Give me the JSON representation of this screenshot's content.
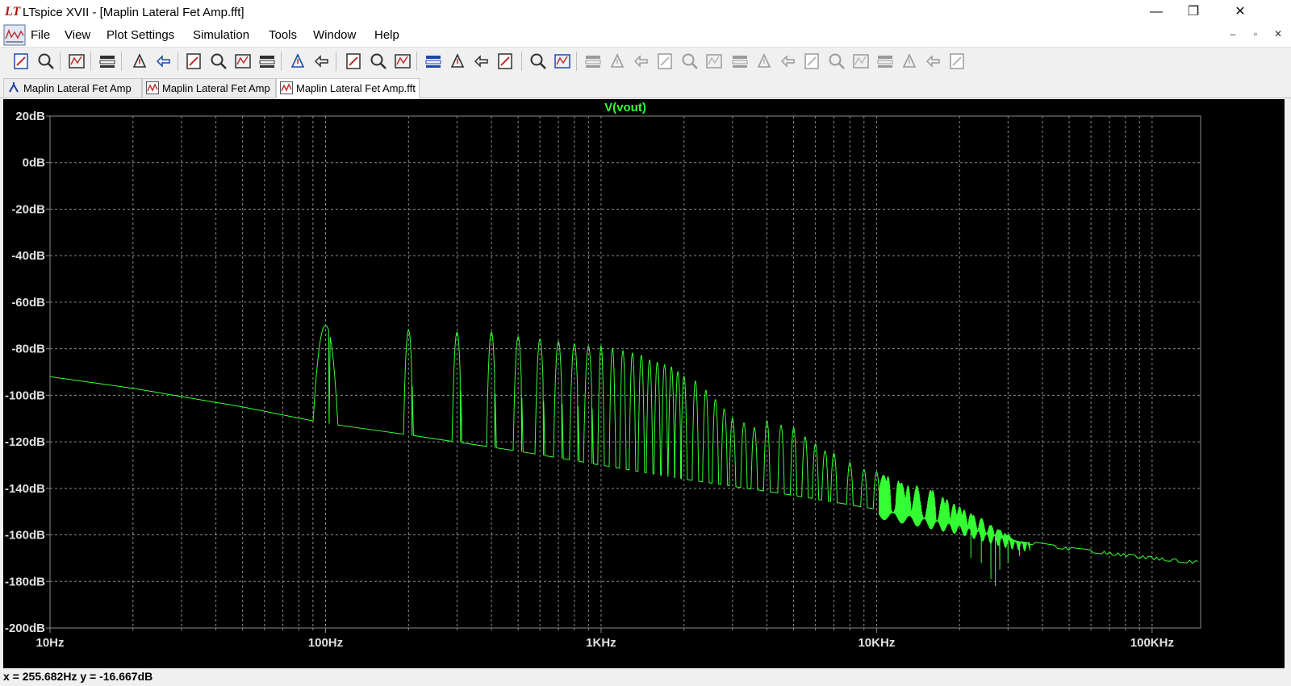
{
  "window": {
    "logo": "LT",
    "title": "LTspice XVII - [Maplin Lateral Fet Amp.fft]",
    "minimize": "—",
    "maximize": "❐",
    "close": "✕"
  },
  "menu": [
    "File",
    "View",
    "Plot Settings",
    "Simulation",
    "Tools",
    "Window",
    "Help"
  ],
  "mdi": {
    "minimize": "–",
    "restore": "▫",
    "close": "✕"
  },
  "toolbar_icons": [
    "new-schematic-icon",
    "open-icon",
    "save-icon",
    "control-panel-icon",
    "run-icon",
    "pan-hand-icon",
    "zoom-in-icon",
    "zoom-area-icon",
    "zoom-out-icon",
    "zoom-cancel-icon",
    "autorange-icon",
    "cursor-icon",
    "tile-horizontal-icon",
    "cascade-icon",
    "tile-vertical-icon",
    "cut-icon",
    "copy-icon",
    "paste-icon",
    "find-icon",
    "print-icon",
    "print-setup-icon",
    "wire-icon",
    "ground-icon",
    "label-icon",
    "resistor-icon",
    "capacitor-icon",
    "inductor-icon",
    "diode-icon",
    "component-icon",
    "move-icon",
    "drag-icon",
    "undo-icon",
    "redo-icon",
    "rotate-icon",
    "mirror-icon",
    "text-icon",
    "spice-directive-icon"
  ],
  "tabs": [
    {
      "label": "Maplin Lateral Fet Amp",
      "icon": "schematic-icon",
      "active": false
    },
    {
      "label": "Maplin Lateral Fet Amp",
      "icon": "waveform-icon",
      "active": false
    },
    {
      "label": "Maplin Lateral Fet Amp.fft",
      "icon": "waveform-icon",
      "active": true
    }
  ],
  "status": {
    "text": "x = 255.682Hz    y = -16.667dB"
  },
  "colors": {
    "trace": "#33ff33",
    "background": "#000000",
    "grid": "#8a8a8a",
    "axis_text": "#e0e0e0",
    "title": "#33ff33"
  },
  "chart_data": {
    "type": "line",
    "title": "V(vout)",
    "x_scale": "log",
    "xlim": [
      10,
      150000
    ],
    "ylim": [
      -200,
      20
    ],
    "x_ticks": [
      10,
      100,
      1000,
      10000,
      100000
    ],
    "x_tick_labels": [
      "10Hz",
      "100Hz",
      "1KHz",
      "10KHz",
      "100KHz"
    ],
    "y_ticks": [
      20,
      0,
      -20,
      -40,
      -60,
      -80,
      -100,
      -120,
      -140,
      -160,
      -180,
      -200
    ],
    "y_tick_labels": [
      "20dB",
      "0dB",
      "-20dB",
      "-40dB",
      "-60dB",
      "-80dB",
      "-100dB",
      "-120dB",
      "-140dB",
      "-160dB",
      "-180dB",
      "-200dB"
    ],
    "grid": true,
    "series": [
      {
        "name": "V(vout)",
        "noise_floor": [
          [
            10,
            -92
          ],
          [
            20,
            -97
          ],
          [
            50,
            -105
          ],
          [
            90,
            -111
          ],
          [
            100,
            -112
          ],
          [
            200,
            -117
          ],
          [
            500,
            -124
          ],
          [
            1000,
            -130
          ],
          [
            2000,
            -136
          ],
          [
            5000,
            -143
          ],
          [
            10000,
            -149
          ],
          [
            20000,
            -156
          ],
          [
            30000,
            -162
          ],
          [
            50000,
            -166
          ],
          [
            100000,
            -170
          ],
          [
            150000,
            -172
          ]
        ],
        "peaks": [
          [
            100,
            -70
          ],
          [
            200,
            -72
          ],
          [
            300,
            -73
          ],
          [
            400,
            -73
          ],
          [
            500,
            -75
          ],
          [
            600,
            -76
          ],
          [
            700,
            -77
          ],
          [
            800,
            -78
          ],
          [
            900,
            -79
          ],
          [
            1000,
            -79
          ],
          [
            1100,
            -80
          ],
          [
            1200,
            -81
          ],
          [
            1300,
            -82
          ],
          [
            1400,
            -83
          ],
          [
            1500,
            -85
          ],
          [
            1600,
            -86
          ],
          [
            1700,
            -87
          ],
          [
            1800,
            -88
          ],
          [
            1900,
            -90
          ],
          [
            2000,
            -92
          ],
          [
            2200,
            -94
          ],
          [
            2400,
            -98
          ],
          [
            2600,
            -102
          ],
          [
            2800,
            -106
          ],
          [
            3000,
            -110
          ],
          [
            3300,
            -112
          ],
          [
            3600,
            -114
          ],
          [
            4000,
            -111
          ],
          [
            4500,
            -113
          ],
          [
            5000,
            -114
          ],
          [
            5500,
            -118
          ],
          [
            6000,
            -121
          ],
          [
            6500,
            -124
          ],
          [
            7000,
            -125
          ],
          [
            8000,
            -129
          ],
          [
            9000,
            -132
          ],
          [
            10000,
            -133
          ],
          [
            11000,
            -135
          ],
          [
            12000,
            -137
          ],
          [
            13000,
            -139
          ],
          [
            14000,
            -139
          ],
          [
            16000,
            -141
          ],
          [
            18000,
            -145
          ],
          [
            20000,
            -148
          ],
          [
            22000,
            -151
          ],
          [
            24000,
            -153
          ],
          [
            26000,
            -156
          ],
          [
            28000,
            -158
          ],
          [
            30000,
            -160
          ],
          [
            32000,
            -163
          ]
        ],
        "dips": [
          [
            22000,
            -170
          ],
          [
            24000,
            -172
          ],
          [
            26000,
            -179
          ],
          [
            27000,
            -182
          ],
          [
            28000,
            -175
          ],
          [
            30000,
            -172
          ],
          [
            33000,
            -169
          ]
        ]
      }
    ]
  }
}
